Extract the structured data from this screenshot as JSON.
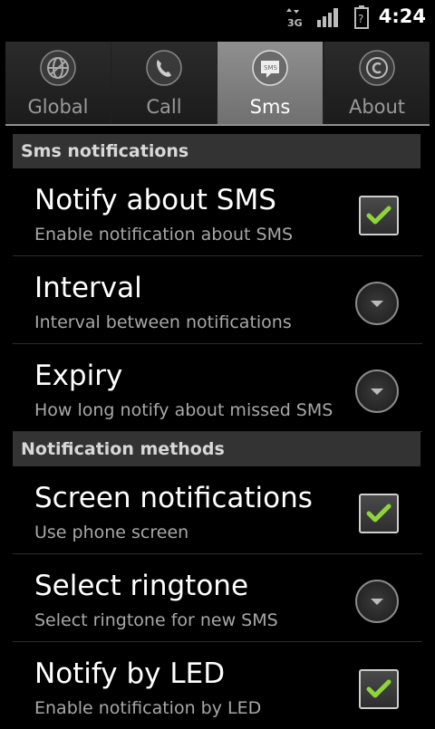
{
  "statusbar": {
    "network_icon": "3g-data-icon",
    "signal_icon": "signal-bars-icon",
    "battery_icon": "battery-unknown-icon",
    "time": "4:24"
  },
  "tabs": [
    {
      "label": "Global",
      "icon": "globe-icon",
      "selected": false
    },
    {
      "label": "Call",
      "icon": "phone-icon",
      "selected": false
    },
    {
      "label": "Sms",
      "icon": "sms-icon",
      "selected": true
    },
    {
      "label": "About",
      "icon": "copyright-icon",
      "selected": false
    }
  ],
  "sections": [
    {
      "header": "Sms notifications",
      "items": [
        {
          "title": "Notify about SMS",
          "summary": "Enable notification about SMS",
          "control": "checkbox",
          "checked": true
        },
        {
          "title": "Interval",
          "summary": "Interval between notifications",
          "control": "dropdown"
        },
        {
          "title": "Expiry",
          "summary": "How long notify about missed SMS",
          "control": "dropdown"
        }
      ]
    },
    {
      "header": "Notification methods",
      "items": [
        {
          "title": "Screen notifications",
          "summary": "Use phone screen",
          "control": "checkbox",
          "checked": true
        },
        {
          "title": "Select ringtone",
          "summary": "Select ringtone for new SMS",
          "control": "dropdown"
        },
        {
          "title": "Notify by LED",
          "summary": "Enable notification by LED",
          "control": "checkbox",
          "checked": true
        }
      ]
    }
  ],
  "colors": {
    "check_green": "#8fd43a",
    "tab_selected": "#7f7f7f"
  }
}
